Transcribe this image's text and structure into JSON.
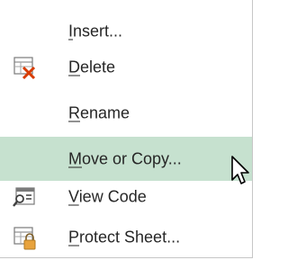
{
  "menu": {
    "items": [
      {
        "accel": "I",
        "rest": "nsert...",
        "icon": null
      },
      {
        "accel": "D",
        "rest": "elete",
        "icon": "delete-sheet-icon"
      },
      {
        "accel": "R",
        "rest": "ename",
        "icon": null
      },
      {
        "accel": "M",
        "rest": "ove or Copy...",
        "icon": null,
        "highlighted": true
      },
      {
        "accel": "V",
        "rest": "iew Code",
        "icon": "view-code-icon"
      },
      {
        "accel": "P",
        "rest": "rotect Sheet...",
        "icon": "protect-sheet-icon"
      }
    ]
  },
  "colors": {
    "hover_bg": "#c6e1cf",
    "text": "#262626",
    "delete_x": "#d83b01",
    "lock": "#e8a33d"
  }
}
